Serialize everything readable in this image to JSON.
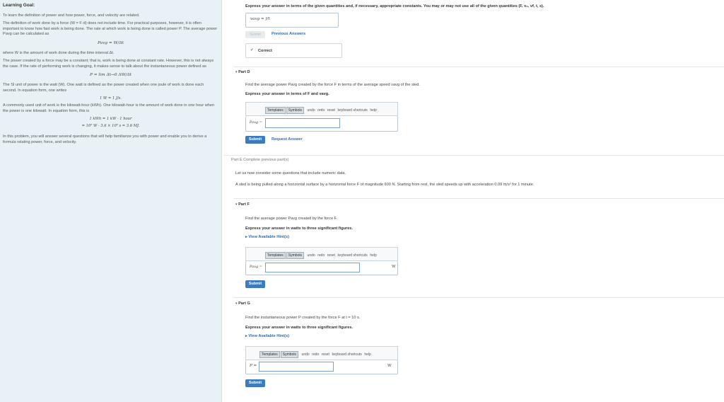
{
  "left": {
    "title": "Learning Goal:",
    "intro": "To learn the definition of power and how power, force, and velocity are related.",
    "p1": "The definition of work done by a force (W = F·d) does not include time. For practical purposes, however, it is often important to know how fast work is being done. The rate at which work is being done is called power P. The average power Pavg can be calculated as",
    "eq1": "Pavg = W/Δt",
    "p2": "where W is the amount of work done during the time interval Δt.",
    "p3": "The power created by a force may be a constant; that is, work is being done at constant rate. However, this is not always the case. If the rate of performing work is changing, it makes sense to talk about the instantaneous power defined as",
    "eq2": "P = lim Δt→0 ΔW/Δt",
    "p4": "The SI unit of power is the watt (W). One watt is defined as the power created when one joule of work is done each second. In equation form, one writes",
    "eq3": "1 W = 1 J/s.",
    "p5": "A commonly used unit of work is the kilowatt-hour (kWh). One kilowatt-hour is the amount of work done in one hour when the power is one kilowatt. In equation form, this is",
    "eq4": "1 kWh = 1 kW · 1 hour",
    "eq5": "= 10³ W · 3.6 × 10³ s = 3.6 MJ.",
    "p6": "In this problem, you will answer several questions that will help familiarize you with power and enable you to derive a formula relating power, force, and velocity."
  },
  "partC": {
    "prompt": "Express your answer in terms of the given quantities and, if necessary, appropriate constants. You may or may not use all of the given quantities (F, v₀, vf, t, s).",
    "answer": "vavg = f/t",
    "submit_label": "Submit",
    "prev_label": "Previous Answers",
    "correct_label": "Correct"
  },
  "partD": {
    "label": "Part D",
    "question": "Find the average power Pavg created by the force F in terms of the average speed vavg of the sled.",
    "instruction": "Express your answer in terms of F and vavg.",
    "var_label": "Pavg =",
    "submit_label": "Submit",
    "request_label": "Request Answer"
  },
  "partE": {
    "status": "Part E  Complete previous part(s)",
    "intro": "Let us now consider some questions that include numeric data.",
    "scenario": "A sled is being pulled along a horizontal surface by a horizontal force F of magnitude 600 N. Starting from rest, the sled speeds up with acceleration 0.09 m/s² for 1 minute."
  },
  "partF": {
    "label": "Part F",
    "question": "Find the average power Pavg created by the force F.",
    "instruction": "Express your answer in watts to three significant figures.",
    "hint_label": "View Available Hint(s)",
    "var_label": "Pavg =",
    "unit": "W",
    "submit_label": "Submit"
  },
  "partG": {
    "label": "Part G",
    "question": "Find the instantaneous power P created by the force F at t = 10 s.",
    "instruction": "Express your answer in watts to three significant figures.",
    "hint_label": "View Available Hint(s)",
    "var_label": "P =",
    "unit": "W",
    "submit_label": "Submit"
  },
  "toolbar": {
    "templates": "Templates",
    "symbols": "Symbols",
    "undo": "undo",
    "redo": "redo",
    "reset": "reset",
    "keyboard": "keyboard shortcuts",
    "help": "help"
  },
  "colors": {
    "accent": "#3e7bbd",
    "panel": "#e8f1f6",
    "correct": "#3a9a3a"
  }
}
